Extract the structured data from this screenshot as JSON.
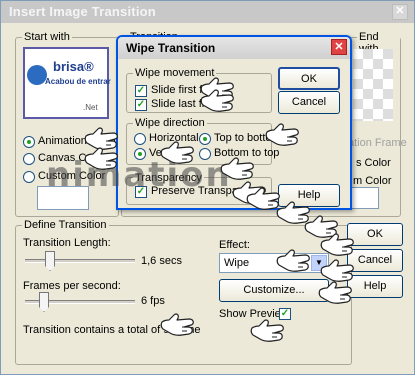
{
  "main": {
    "title": "Insert Image Transition",
    "start_with": {
      "legend": "Start with",
      "logo_text": "brisa®",
      "logo_sub": "Acabou de entrar",
      "logo_net": ".Net",
      "options": [
        "Animation Frame",
        "Canvas Color",
        "Custom Color"
      ]
    },
    "transition_legend": "Transition",
    "end_with": {
      "legend": "End with",
      "options_partial": [
        "ation Frame",
        "s Color",
        "m Color"
      ]
    },
    "define": {
      "legend": "Define Transition",
      "length_label": "Transition Length:",
      "length_value": "1,6 secs",
      "length_fraction": 0.2,
      "fps_label": "Frames per second:",
      "fps_value": "6 fps",
      "fps_fraction": 0.14,
      "total_text": "Transition contains a total of 9 frame"
    },
    "effect": {
      "label": "Effect:",
      "value": "Wipe",
      "customize": "Customize...",
      "show_preview": "Show Preview"
    },
    "buttons": {
      "ok": "OK",
      "cancel": "Cancel",
      "help": "Help"
    }
  },
  "wipe": {
    "title": "Wipe Transition",
    "movement": {
      "legend": "Wipe movement",
      "slide_first": "Slide first frame",
      "slide_last": "Slide last frame"
    },
    "direction": {
      "legend": "Wipe direction",
      "horizontal": "Horizontal",
      "vertical": "Vertical",
      "top_bottom": "Top to bottom",
      "bottom_top": "Bottom to top"
    },
    "transparency": {
      "legend": "Transparency",
      "preserve": "Preserve Transparency"
    },
    "buttons": {
      "ok": "OK",
      "cancel": "Cancel",
      "help": "Help"
    }
  },
  "watermark": "nimation"
}
